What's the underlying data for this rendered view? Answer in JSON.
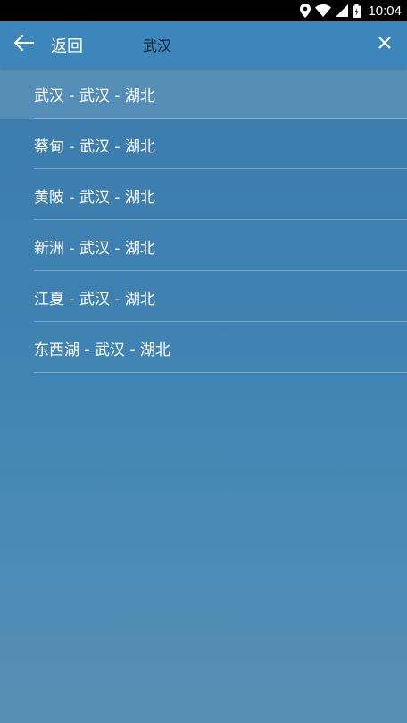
{
  "status_bar": {
    "time": "10:04",
    "icons": [
      "location-icon",
      "wifi-icon",
      "signal-icon",
      "battery-icon"
    ]
  },
  "header": {
    "back_label": "返回",
    "search_value": "武汉",
    "back_icon": "arrow-left-icon",
    "clear_icon": "close-icon"
  },
  "results": [
    "武汉 - 武汉 - 湖北",
    "蔡甸 - 武汉 - 湖北",
    "黄陂 - 武汉 - 湖北",
    "新洲 - 武汉 - 湖北",
    "江夏 - 武汉 - 湖北",
    "东西湖 - 武汉 - 湖北"
  ],
  "colors": {
    "app_bar": "#3d86bb",
    "background_top": "#3a7aaa",
    "background_bottom": "#578fb3",
    "text": "#ffffff"
  }
}
